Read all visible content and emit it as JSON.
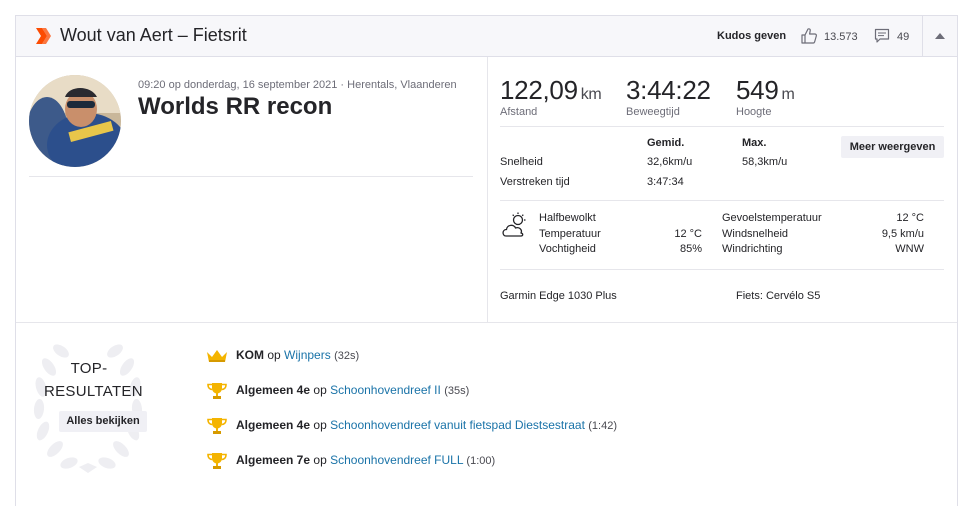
{
  "header": {
    "title": "Wout van Aert – Fietsrit",
    "kudos_label": "Kudos geven",
    "kudos_count": "13.573",
    "comment_count": "49"
  },
  "activity": {
    "meta": "09:20 op donderdag, 16 september 2021 · Herentals, Vlaanderen",
    "name": "Worlds RR recon"
  },
  "stats": {
    "distance": {
      "value": "122,09",
      "unit": "km",
      "label": "Afstand"
    },
    "moving_time": {
      "value": "3:44:22",
      "label": "Beweegtijd"
    },
    "elevation": {
      "value": "549",
      "unit": "m",
      "label": "Hoogte"
    }
  },
  "details": {
    "col_avg": "Gemid.",
    "col_max": "Max.",
    "more_button": "Meer weergeven",
    "speed_label": "Snelheid",
    "speed_avg": "32,6km/u",
    "speed_max": "58,3km/u",
    "elapsed_label": "Verstreken tijd",
    "elapsed_value": "3:47:34"
  },
  "weather": {
    "condition": "Halfbewolkt",
    "temp_label": "Temperatuur",
    "temp_value": "12 °C",
    "humidity_label": "Vochtigheid",
    "humidity_value": "85%",
    "feels_label": "Gevoelstemperatuur",
    "feels_value": "12 °C",
    "wind_speed_label": "Windsnelheid",
    "wind_speed_value": "9,5 km/u",
    "wind_dir_label": "Windrichting",
    "wind_dir_value": "WNW"
  },
  "gear": {
    "device": "Garmin Edge 1030 Plus",
    "bike": "Fiets: Cervélo S5"
  },
  "top_results": {
    "title_line1": "TOP-",
    "title_line2": "RESULTATEN",
    "view_all": "Alles bekijken",
    "items": [
      {
        "achievement": "KOM",
        "op": "op",
        "segment": "Wijnpers",
        "time": "(32s)",
        "icon": "crown-icon"
      },
      {
        "achievement": "Algemeen 4e",
        "op": "op",
        "segment": "Schoonhovendreef II",
        "time": "(35s)",
        "icon": "trophy-icon"
      },
      {
        "achievement": "Algemeen 4e",
        "op": "op",
        "segment": "Schoonhovendreef vanuit fietspad Diestsestraat",
        "time": "(1:42)",
        "icon": "trophy-icon"
      },
      {
        "achievement": "Algemeen 7e",
        "op": "op",
        "segment": "Schoonhovendreef FULL",
        "time": "(1:00)",
        "icon": "trophy-icon"
      }
    ]
  },
  "colors": {
    "brand_orange": "#fc4c02",
    "link_blue": "#1a73a8",
    "gold": "#f4b400"
  }
}
